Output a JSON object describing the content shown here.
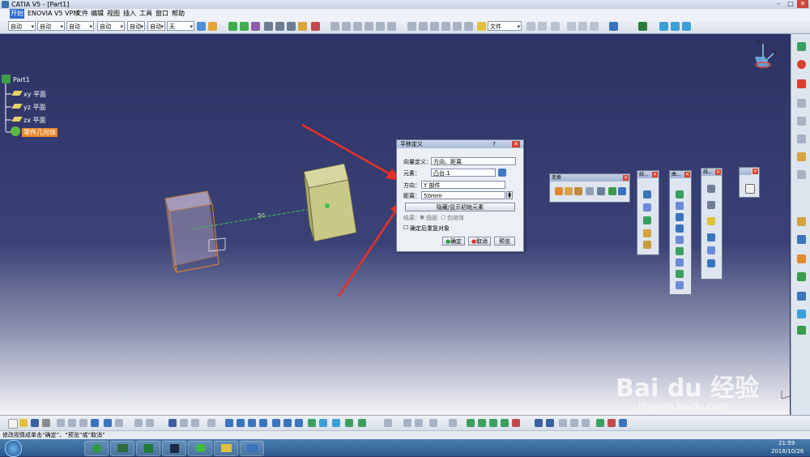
{
  "window": {
    "title": "CATIA V5 - [Part1]"
  },
  "menu": [
    "开始",
    "ENOVIA V5 VPM",
    "文件",
    "编辑",
    "视图",
    "插入",
    "工具",
    "窗口",
    "帮助"
  ],
  "toolbar": {
    "selects": [
      "自动",
      "自动",
      "自动",
      "自动",
      "自动",
      "自动",
      "无"
    ],
    "file_select": "文件"
  },
  "tree": {
    "root": "Part1",
    "items": [
      "xy 平面",
      "yz 平面",
      "zx 平面",
      "零件几何体"
    ]
  },
  "viewport": {
    "dimension": "50"
  },
  "dialog": {
    "title": "平移定义",
    "help": "?",
    "vector_def_label": "向量定义：",
    "vector_def_value": "方向、距离",
    "element_label": "元素：",
    "element_value": "凸台.1",
    "direction_label": "方向：",
    "direction_value": "Y 部件",
    "distance_label": "距离：",
    "distance_value": "50mm",
    "hide_show_button": "隐藏/显示初始元素",
    "result_label": "结果：",
    "result_option1": "曲面",
    "result_option2": "包络体",
    "reuse_check": "确定后重复对象",
    "ok": "确定",
    "cancel": "取消",
    "preview": "预览"
  },
  "floating": {
    "transform": "变换",
    "tb2": "线...",
    "tb3": "曲...",
    "tb4": "线..."
  },
  "status": {
    "text": "修改视情成单击“确定”、“预览”或“取消”"
  },
  "clock": {
    "time": "21:59",
    "date": "2018/10/26"
  },
  "watermark": {
    "brand": "Bai du 经验",
    "url": "jingyan.baidu.com"
  },
  "colors": {
    "viewport_top": "#2d3364",
    "accent": "#2f6ad0",
    "arrow": "#e8302a"
  }
}
